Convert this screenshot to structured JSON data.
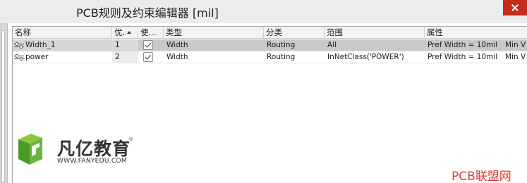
{
  "window": {
    "title": "PCB规则及约束编辑器 [mil]"
  },
  "table": {
    "columns": [
      "名称",
      "优.",
      "使...",
      "类型",
      "分类",
      "范围",
      "属性"
    ],
    "rows": [
      {
        "name": "Width_1",
        "priority": "1",
        "enabled": true,
        "type": "Width",
        "category": "Routing",
        "scope": "All",
        "attr1": "Pref Width = 10mil",
        "attr2": "Min V",
        "selected": true
      },
      {
        "name": "power",
        "priority": "2",
        "enabled": true,
        "type": "Width",
        "category": "Routing",
        "scope": "InNetClass('POWER')",
        "attr1": "Pref Width = 10mil",
        "attr2": "Min V",
        "selected": false
      }
    ]
  },
  "branding": {
    "logo_cn": "凡亿教育",
    "logo_reg": "®",
    "logo_url": "WWW.FANYEDU.COM",
    "watermark": "PCB联盟网"
  },
  "colors": {
    "logo_green": "#5aaa2c",
    "watermark_red": "#e03838",
    "selected_row": "#c9c9c9"
  }
}
